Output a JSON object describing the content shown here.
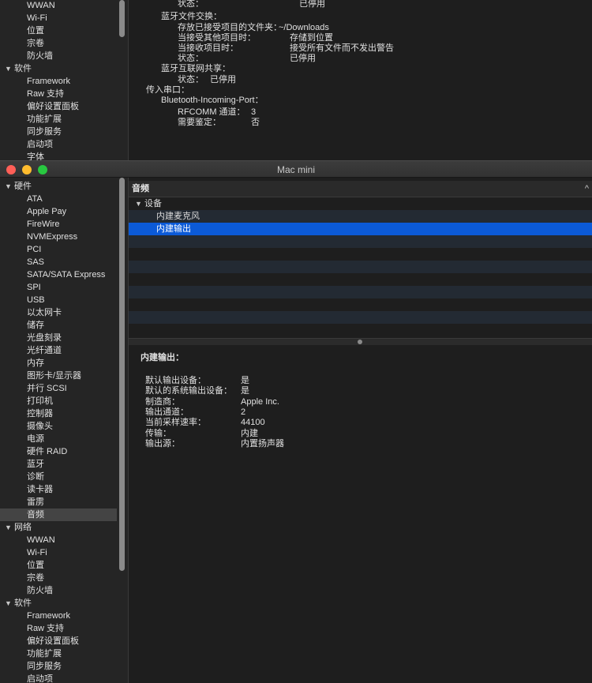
{
  "bg_window": {
    "sidebar": [
      {
        "label": "WWAN",
        "type": "child"
      },
      {
        "label": "Wi-Fi",
        "type": "child"
      },
      {
        "label": "位置",
        "type": "child"
      },
      {
        "label": "宗卷",
        "type": "child"
      },
      {
        "label": "防火墙",
        "type": "child"
      },
      {
        "label": "软件",
        "type": "group"
      },
      {
        "label": "Framework",
        "type": "child"
      },
      {
        "label": "Raw 支持",
        "type": "child"
      },
      {
        "label": "偏好设置面板",
        "type": "child"
      },
      {
        "label": "功能扩展",
        "type": "child"
      },
      {
        "label": "同步服务",
        "type": "child"
      },
      {
        "label": "启动项",
        "type": "child"
      },
      {
        "label": "字体",
        "type": "child"
      }
    ],
    "detail": [
      {
        "text": "状态：",
        "indent": 3
      },
      {
        "text": "已停用",
        "col": "status1"
      },
      {
        "text": "蓝牙文件交换：",
        "indent": 2
      },
      {
        "text": "存放已接受项目的文件夹：",
        "indent": 3
      },
      {
        "text": "~/Downloads",
        "col": "v1"
      },
      {
        "text": "当接受其他项目时：",
        "indent": 3
      },
      {
        "text": "存储到位置",
        "col": "v2"
      },
      {
        "text": "当接收项目时：",
        "indent": 3
      },
      {
        "text": "接受所有文件而不发出警告",
        "col": "v2"
      },
      {
        "text": "状态：",
        "indent": 3
      },
      {
        "text": "已停用",
        "col": "v2"
      },
      {
        "text": "蓝牙互联网共享：",
        "indent": 2
      },
      {
        "text": "状态：",
        "indent": 3
      },
      {
        "text": "已停用",
        "col": "v3"
      },
      {
        "text": "传入串口：",
        "indent": 1
      },
      {
        "text": "Bluetooth-Incoming-Port：",
        "indent": 2
      },
      {
        "text": "RFCOMM 通道：",
        "indent": 3
      },
      {
        "text": "3",
        "col": "v4"
      },
      {
        "text": "需要鉴定：",
        "indent": 3
      },
      {
        "text": "否",
        "col": "v4"
      }
    ]
  },
  "fg_window": {
    "title": "Mac mini",
    "traffic_lights": {
      "close": "#ff5f57",
      "minimize": "#febc2e",
      "zoom": "#28c840"
    },
    "sidebar": [
      {
        "label": "硬件",
        "type": "group"
      },
      {
        "label": "ATA",
        "type": "child"
      },
      {
        "label": "Apple Pay",
        "type": "child"
      },
      {
        "label": "FireWire",
        "type": "child"
      },
      {
        "label": "NVMExpress",
        "type": "child"
      },
      {
        "label": "PCI",
        "type": "child"
      },
      {
        "label": "SAS",
        "type": "child"
      },
      {
        "label": "SATA/SATA Express",
        "type": "child"
      },
      {
        "label": "SPI",
        "type": "child"
      },
      {
        "label": "USB",
        "type": "child"
      },
      {
        "label": "以太网卡",
        "type": "child"
      },
      {
        "label": "储存",
        "type": "child"
      },
      {
        "label": "光盘刻录",
        "type": "child"
      },
      {
        "label": "光纤通道",
        "type": "child"
      },
      {
        "label": "内存",
        "type": "child"
      },
      {
        "label": "图形卡/显示器",
        "type": "child"
      },
      {
        "label": "并行 SCSI",
        "type": "child"
      },
      {
        "label": "打印机",
        "type": "child"
      },
      {
        "label": "控制器",
        "type": "child"
      },
      {
        "label": "摄像头",
        "type": "child"
      },
      {
        "label": "电源",
        "type": "child"
      },
      {
        "label": "硬件 RAID",
        "type": "child"
      },
      {
        "label": "蓝牙",
        "type": "child"
      },
      {
        "label": "诊断",
        "type": "child"
      },
      {
        "label": "读卡器",
        "type": "child"
      },
      {
        "label": "雷雳",
        "type": "child"
      },
      {
        "label": "音频",
        "type": "child",
        "selected": true
      },
      {
        "label": "网络",
        "type": "group"
      },
      {
        "label": "WWAN",
        "type": "child"
      },
      {
        "label": "Wi-Fi",
        "type": "child"
      },
      {
        "label": "位置",
        "type": "child"
      },
      {
        "label": "宗卷",
        "type": "child"
      },
      {
        "label": "防火墙",
        "type": "child"
      },
      {
        "label": "软件",
        "type": "group"
      },
      {
        "label": "Framework",
        "type": "child"
      },
      {
        "label": "Raw 支持",
        "type": "child"
      },
      {
        "label": "偏好设置面板",
        "type": "child"
      },
      {
        "label": "功能扩展",
        "type": "child"
      },
      {
        "label": "同步服务",
        "type": "child"
      },
      {
        "label": "启动项",
        "type": "child"
      }
    ],
    "column_header": "音频",
    "column_sort_icon": "^",
    "outline": {
      "group": "设备",
      "items": [
        {
          "label": "内建麦克风",
          "selected": false
        },
        {
          "label": "内建输出",
          "selected": true
        }
      ]
    },
    "info": {
      "title": "内建输出：",
      "rows": [
        {
          "key": "默认输出设备：",
          "value": "是"
        },
        {
          "key": "默认的系统输出设备：",
          "value": "是"
        },
        {
          "key": "制造商：",
          "value": "Apple Inc."
        },
        {
          "key": "输出通道：",
          "value": "2"
        },
        {
          "key": "当前采样速率：",
          "value": "44100"
        },
        {
          "key": "传输：",
          "value": "内建"
        },
        {
          "key": "输出源：",
          "value": "内置扬声器"
        }
      ]
    }
  }
}
